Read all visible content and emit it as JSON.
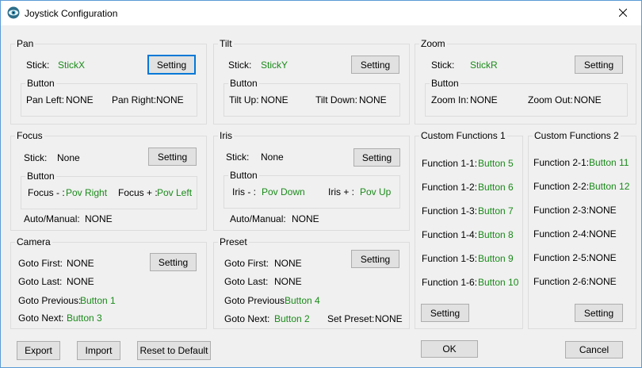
{
  "window": {
    "title": "Joystick Configuration"
  },
  "pan": {
    "title": "Pan",
    "stick_label": "Stick:",
    "stick_value": "StickX",
    "setting_label": "Setting",
    "button_group": "Button",
    "left_label": "Pan Left:",
    "left_value": "NONE",
    "right_label": "Pan Right:",
    "right_value": "NONE"
  },
  "tilt": {
    "title": "Tilt",
    "stick_label": "Stick:",
    "stick_value": "StickY",
    "setting_label": "Setting",
    "button_group": "Button",
    "up_label": "Tilt Up:",
    "up_value": "NONE",
    "down_label": "Tilt Down:",
    "down_value": "NONE"
  },
  "zoom": {
    "title": "Zoom",
    "stick_label": "Stick:",
    "stick_value": "StickR",
    "setting_label": "Setting",
    "button_group": "Button",
    "in_label": "Zoom In:",
    "in_value": "NONE",
    "out_label": "Zoom Out:",
    "out_value": "NONE"
  },
  "focus": {
    "title": "Focus",
    "stick_label": "Stick:",
    "stick_value": "None",
    "setting_label": "Setting",
    "button_group": "Button",
    "minus_label": "Focus - :",
    "minus_value": "Pov Right",
    "plus_label": "Focus + :",
    "plus_value": "Pov Left",
    "auto_label": "Auto/Manual:",
    "auto_value": "NONE"
  },
  "iris": {
    "title": "Iris",
    "stick_label": "Stick:",
    "stick_value": "None",
    "setting_label": "Setting",
    "button_group": "Button",
    "minus_label": "Iris - :",
    "minus_value": "Pov Down",
    "plus_label": "Iris + :",
    "plus_value": "Pov Up",
    "auto_label": "Auto/Manual:",
    "auto_value": "NONE"
  },
  "camera": {
    "title": "Camera",
    "setting_label": "Setting",
    "first_label": "Goto First:",
    "first_value": "NONE",
    "last_label": "Goto Last:",
    "last_value": "NONE",
    "prev_label": "Goto Previous:",
    "prev_value": "Button 1",
    "next_label": "Goto Next:",
    "next_value": "Button 3"
  },
  "preset": {
    "title": "Preset",
    "setting_label": "Setting",
    "first_label": "Goto First:",
    "first_value": "NONE",
    "last_label": "Goto Last:",
    "last_value": "NONE",
    "prev_label": "Goto Previous:",
    "prev_value": "Button 4",
    "next_label": "Goto Next:",
    "next_value": "Button 2",
    "set_label": "Set Preset:",
    "set_value": "NONE"
  },
  "custom1": {
    "title": "Custom Functions 1",
    "setting_label": "Setting",
    "items": [
      {
        "label": "Function 1-1:",
        "value": "Button 5"
      },
      {
        "label": "Function 1-2:",
        "value": "Button 6"
      },
      {
        "label": "Function 1-3:",
        "value": "Button 7"
      },
      {
        "label": "Function 1-4:",
        "value": "Button 8"
      },
      {
        "label": "Function 1-5:",
        "value": "Button 9"
      },
      {
        "label": "Function 1-6:",
        "value": "Button 10"
      }
    ]
  },
  "custom2": {
    "title": "Custom Functions 2",
    "setting_label": "Setting",
    "items": [
      {
        "label": "Function 2-1:",
        "value": "Button 11"
      },
      {
        "label": "Function 2-2:",
        "value": "Button 12"
      },
      {
        "label": "Function 2-3:",
        "value": "NONE"
      },
      {
        "label": "Function 2-4:",
        "value": "NONE"
      },
      {
        "label": "Function 2-5:",
        "value": "NONE"
      },
      {
        "label": "Function 2-6:",
        "value": "NONE"
      }
    ]
  },
  "footer": {
    "export_label": "Export",
    "import_label": "Import",
    "reset_label": "Reset to Default",
    "ok_label": "OK",
    "cancel_label": "Cancel"
  },
  "colors": {
    "assigned": "#1a8a1a",
    "focus_border": "#0078d7",
    "window_border": "#5a9bd5"
  },
  "icons": {
    "app": "eye-icon",
    "close": "close-icon"
  }
}
